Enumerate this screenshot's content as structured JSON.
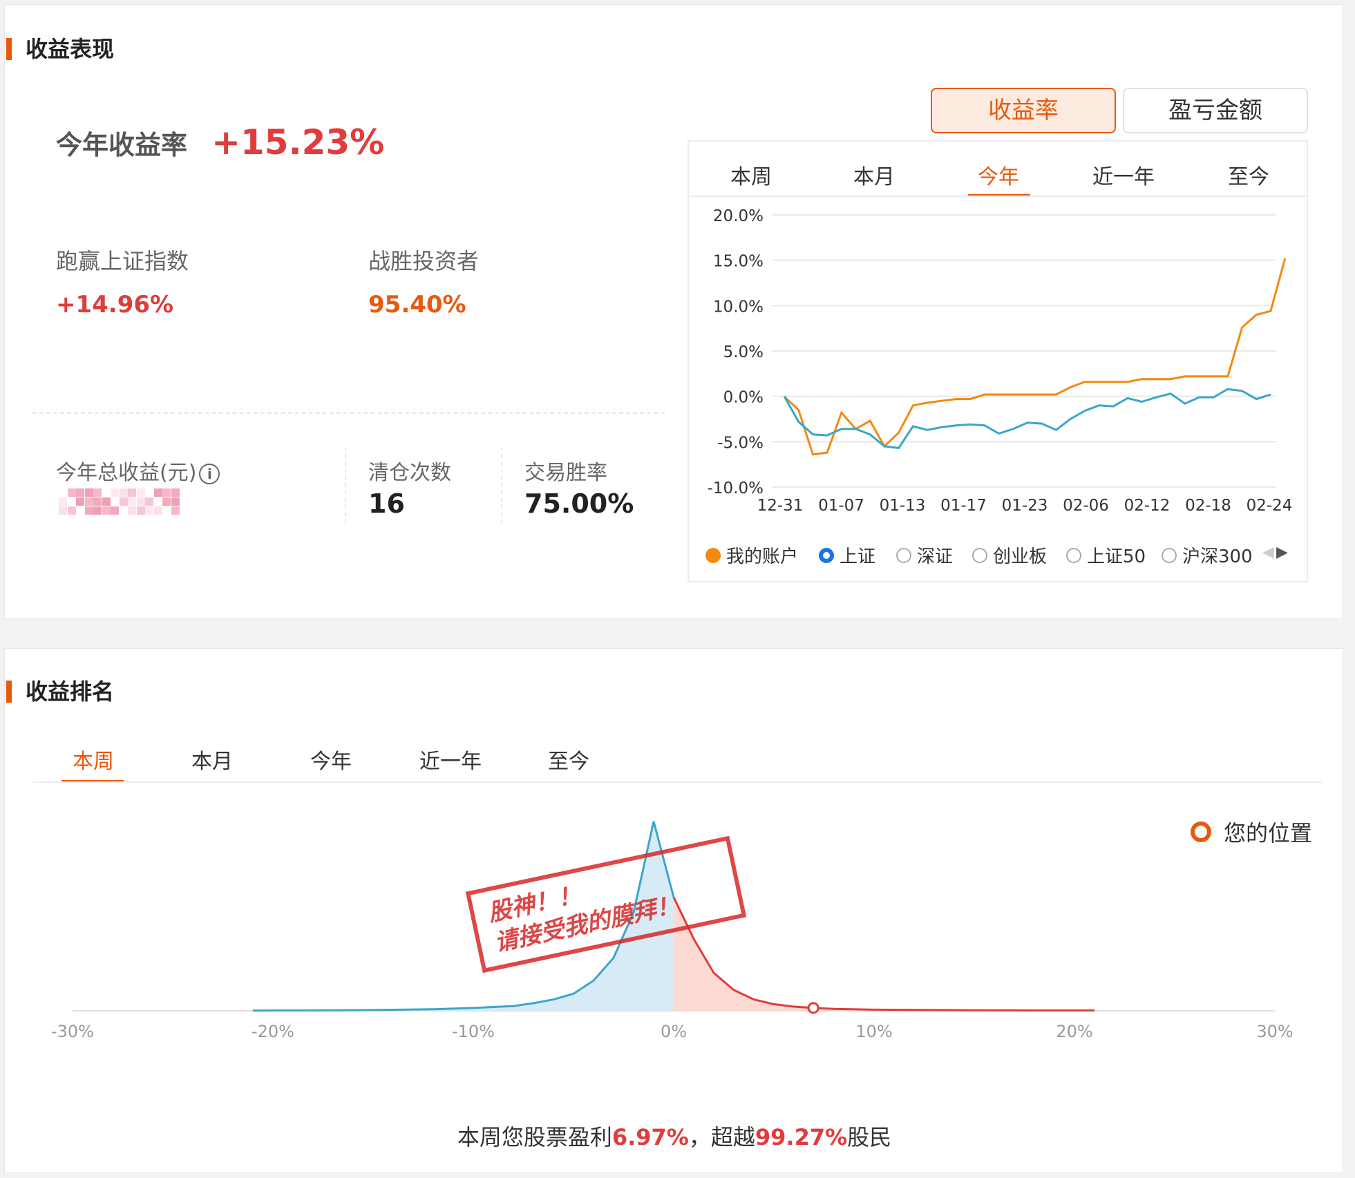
{
  "performance": {
    "section_title": "收益表现",
    "ytd_label": "今年收益率",
    "ytd_value": "+15.23%",
    "beat_index_label": "跑赢上证指数",
    "beat_index_value": "+14.96%",
    "beat_investors_label": "战胜投资者",
    "beat_investors_value": "95.40%",
    "total_profit_label": "今年总收益(元)",
    "info_icon": "i",
    "clear_count_label": "清仓次数",
    "clear_count_value": "16",
    "win_rate_label": "交易胜率",
    "win_rate_value": "75.00%",
    "mode_buttons": [
      "收益率",
      "盈亏金额"
    ],
    "period_tabs": [
      "本周",
      "本月",
      "今年",
      "近一年",
      "至今"
    ],
    "active_period": "今年",
    "legend": [
      "我的账户",
      "上证",
      "深证",
      "创业板",
      "上证50",
      "沪深300"
    ]
  },
  "chart_data": [
    {
      "type": "line",
      "ylim": [
        -10,
        20
      ],
      "y_ticks": [
        "20.0%",
        "15.0%",
        "10.0%",
        "5.0%",
        "0.0%",
        "-5.0%",
        "-10.0%"
      ],
      "x_tick_labels": [
        "12-31",
        "01-07",
        "01-13",
        "01-17",
        "01-23",
        "02-06",
        "02-12",
        "02-18",
        "02-24"
      ],
      "series": [
        {
          "name": "我的账户",
          "color": "#f5890f",
          "values": [
            0,
            -1.5,
            -6.4,
            -6.2,
            -1.8,
            -3.6,
            -2.7,
            -5.5,
            -4,
            -1,
            -0.7,
            -0.5,
            -0.3,
            -0.3,
            0.2,
            0.2,
            0.2,
            0.2,
            0.2,
            0.2,
            1.0,
            1.6,
            1.6,
            1.6,
            1.6,
            1.9,
            1.9,
            1.9,
            2.2,
            2.2,
            2.2,
            2.2,
            7.6,
            9.0,
            9.4,
            15.2
          ]
        },
        {
          "name": "上证",
          "color": "#3aa6c9",
          "values": [
            0,
            -2.8,
            -4.2,
            -4.3,
            -3.6,
            -3.6,
            -4.2,
            -5.5,
            -5.7,
            -3.3,
            -3.7,
            -3.4,
            -3.2,
            -3.1,
            -3.2,
            -4.1,
            -3.6,
            -2.9,
            -3.0,
            -3.7,
            -2.5,
            -1.6,
            -1.0,
            -1.1,
            -0.2,
            -0.6,
            -0.1,
            0.3,
            -0.8,
            -0.1,
            -0.1,
            0.8,
            0.6,
            -0.3,
            0.2
          ]
        }
      ]
    },
    {
      "type": "area",
      "xlim": [
        -30,
        30
      ],
      "x_tick_labels": [
        "-30%",
        "-20%",
        "-10%",
        "0%",
        "10%",
        "20%",
        "30%"
      ],
      "x": [
        -21,
        -18,
        -15,
        -12,
        -10,
        -8,
        -7,
        -6,
        -5,
        -4,
        -3,
        -2,
        -1,
        0,
        1,
        2,
        3,
        4,
        5,
        6,
        7,
        8,
        10,
        13,
        15,
        18,
        21
      ],
      "values": [
        0.1,
        0.2,
        0.4,
        0.8,
        1.5,
        2.5,
        4,
        6,
        9,
        16,
        28,
        52,
        100,
        60,
        38,
        20,
        11,
        6,
        3.5,
        2.2,
        1.5,
        1.0,
        0.6,
        0.4,
        0.3,
        0.2,
        0.2
      ],
      "marker": {
        "name": "您的位置",
        "x": 6.97
      },
      "legend": "您的位置"
    }
  ],
  "ranking": {
    "section_title": "收益排名",
    "period_tabs": [
      "本周",
      "本月",
      "今年",
      "近一年",
      "至今"
    ],
    "active_period": "本周",
    "legend_label": "您的位置",
    "caption_prefix": "本周您股票盈利",
    "profit_value": "6.97%",
    "caption_mid": "，超越",
    "beat_value": "99.27%",
    "caption_suffix": "股民",
    "stamp_line1": "股神！！",
    "stamp_line2": "请接受我的膜拜！"
  }
}
